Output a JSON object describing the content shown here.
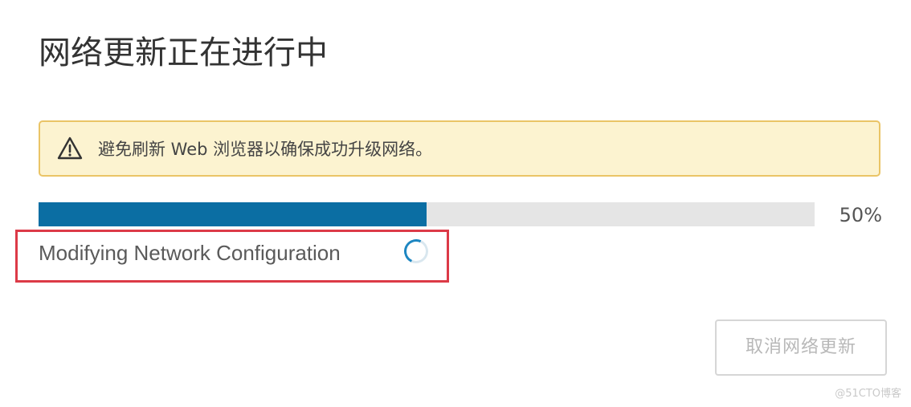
{
  "page": {
    "title": "网络更新正在进行中"
  },
  "alert": {
    "icon": "warning-icon",
    "message": "避免刷新 Web 浏览器以确保成功升级网络。",
    "background_color": "#fcf3d0",
    "border_color": "#eac466"
  },
  "progress": {
    "value": 0.5,
    "percent_label": "50%",
    "fill_color": "#0b6ea3",
    "track_color": "#e5e5e5"
  },
  "status": {
    "text": "Modifying Network Configuration",
    "spinner_icon": "loading-spinner-icon",
    "highlight_color": "#dc3a47"
  },
  "actions": {
    "cancel_label": "取消网络更新",
    "cancel_enabled": false
  },
  "watermark": {
    "text": "@51CTO博客"
  }
}
